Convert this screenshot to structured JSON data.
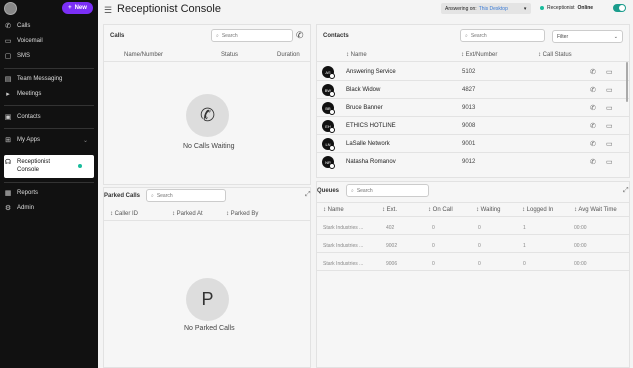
{
  "sidebar": {
    "new_label": "New",
    "items": [
      {
        "label": "Calls",
        "icon": "phone-icon"
      },
      {
        "label": "Voicemail",
        "icon": "voicemail-icon"
      },
      {
        "label": "SMS",
        "icon": "sms-icon"
      },
      {
        "label": "Team Messaging",
        "icon": "team-messaging-icon"
      },
      {
        "label": "Meetings",
        "icon": "video-icon"
      },
      {
        "label": "Contacts",
        "icon": "contacts-icon"
      },
      {
        "label": "My Apps",
        "icon": "apps-icon"
      },
      {
        "label": "Receptionist",
        "label2": "Console",
        "icon": "headset-icon"
      },
      {
        "label": "Reports",
        "icon": "reports-icon"
      },
      {
        "label": "Admin",
        "icon": "admin-icon"
      }
    ]
  },
  "header": {
    "title": "Receptionist Console",
    "answering_prefix": "Answering on:",
    "answering_value": "This Desktop",
    "status_prefix": "Receptionist",
    "status_value": "Online"
  },
  "calls": {
    "title": "Calls",
    "search_placeholder": "Search",
    "columns": [
      "Name/Number",
      "Status",
      "Duration"
    ],
    "empty_text": "No Calls Waiting"
  },
  "contacts": {
    "title": "Contacts",
    "search_placeholder": "Search",
    "filter_label": "Filter",
    "columns": [
      "Name",
      "Ext/Number",
      "Call Status"
    ],
    "rows": [
      {
        "initials": "AS",
        "name": "Answering Service",
        "ext": "5102"
      },
      {
        "initials": "BW",
        "name": "Black Widow",
        "ext": "4827"
      },
      {
        "initials": "BB",
        "name": "Bruce Banner",
        "ext": "9013"
      },
      {
        "initials": "EH",
        "name": "ETHICS HOTLINE",
        "ext": "9008"
      },
      {
        "initials": "LN",
        "name": "LaSalle Network",
        "ext": "9001"
      },
      {
        "initials": "NR",
        "name": "Natasha Romanov",
        "ext": "9012"
      }
    ]
  },
  "parked": {
    "title": "Parked Calls",
    "search_placeholder": "Search",
    "columns": [
      "Caller ID",
      "Parked At",
      "Parked By"
    ],
    "empty_glyph": "P",
    "empty_text": "No Parked Calls"
  },
  "queues": {
    "title": "Queues",
    "search_placeholder": "Search",
    "columns": [
      "Name",
      "Ext.",
      "On Call",
      "Waiting",
      "Logged In",
      "Avg Wait Time"
    ],
    "rows": [
      {
        "name": "Stark Industries ...",
        "ext": "402",
        "on_call": "0",
        "waiting": "0",
        "logged_in": "1",
        "avg_wait": "00:00"
      },
      {
        "name": "Stark Industries ...",
        "ext": "9002",
        "on_call": "0",
        "waiting": "0",
        "logged_in": "1",
        "avg_wait": "00:00"
      },
      {
        "name": "Stark Industries ...",
        "ext": "9006",
        "on_call": "0",
        "waiting": "0",
        "logged_in": "0",
        "avg_wait": "00:00"
      }
    ]
  }
}
